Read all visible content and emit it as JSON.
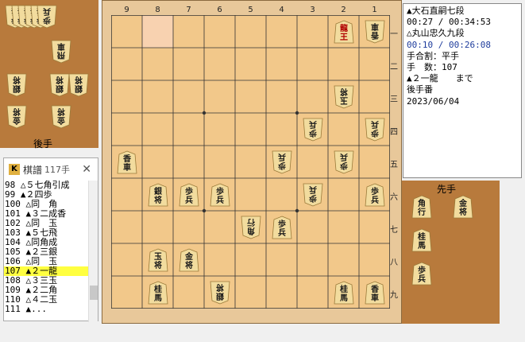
{
  "gote_hand": {
    "label": "後手",
    "pieces": [
      {
        "kind": "歩",
        "label": "歩兵"
      },
      {
        "kind": "歩",
        "label": "歩兵"
      },
      {
        "kind": "歩",
        "label": "歩兵"
      },
      {
        "kind": "歩",
        "label": "歩兵"
      },
      {
        "kind": "歩",
        "label": "歩兵"
      },
      {
        "kind": "歩",
        "label": "歩兵"
      },
      {
        "kind": "飛",
        "label": "飛車"
      },
      {
        "kind": "銀",
        "label": "銀将"
      },
      {
        "kind": "銀",
        "label": "銀将"
      },
      {
        "kind": "銀",
        "label": "銀将"
      },
      {
        "kind": "金",
        "label": "金将"
      },
      {
        "kind": "香",
        "label": "香車"
      },
      {
        "kind": "金",
        "label": "金将"
      }
    ]
  },
  "sente_hand": {
    "label": "先手",
    "pieces": [
      {
        "kind": "角",
        "label": "角行"
      },
      {
        "kind": "金",
        "label": "金将"
      },
      {
        "kind": "桂",
        "label": "桂馬"
      },
      {
        "kind": "歩",
        "label": "歩兵"
      }
    ]
  },
  "board": {
    "files": [
      "9",
      "8",
      "7",
      "6",
      "5",
      "4",
      "3",
      "2",
      "1"
    ],
    "ranks": [
      "一",
      "二",
      "三",
      "四",
      "五",
      "六",
      "七",
      "八",
      "九"
    ],
    "highlight": {
      "file": 8,
      "rank": 1
    },
    "pieces": [
      {
        "file": 2,
        "rank": 1,
        "label": "龍王",
        "owner": "sente"
      },
      {
        "file": 1,
        "rank": 1,
        "label": "香車",
        "owner": "gote"
      },
      {
        "file": 2,
        "rank": 3,
        "label": "玉将",
        "owner": "gote"
      },
      {
        "file": 3,
        "rank": 4,
        "label": "歩兵",
        "owner": "gote"
      },
      {
        "file": 1,
        "rank": 4,
        "label": "歩兵",
        "owner": "gote"
      },
      {
        "file": 9,
        "rank": 5,
        "label": "香車",
        "owner": "sente"
      },
      {
        "file": 4,
        "rank": 5,
        "label": "歩兵",
        "owner": "gote"
      },
      {
        "file": 2,
        "rank": 5,
        "label": "歩兵",
        "owner": "gote"
      },
      {
        "file": 8,
        "rank": 6,
        "label": "銀将",
        "owner": "sente"
      },
      {
        "file": 7,
        "rank": 6,
        "label": "歩兵",
        "owner": "sente"
      },
      {
        "file": 6,
        "rank": 6,
        "label": "歩兵",
        "owner": "sente"
      },
      {
        "file": 3,
        "rank": 6,
        "label": "歩兵",
        "owner": "gote"
      },
      {
        "file": 1,
        "rank": 6,
        "label": "歩兵",
        "owner": "sente"
      },
      {
        "file": 5,
        "rank": 7,
        "label": "角行",
        "owner": "gote"
      },
      {
        "file": 4,
        "rank": 7,
        "label": "歩兵",
        "owner": "sente"
      },
      {
        "file": 8,
        "rank": 8,
        "label": "玉将",
        "owner": "sente"
      },
      {
        "file": 7,
        "rank": 8,
        "label": "金将",
        "owner": "sente"
      },
      {
        "file": 8,
        "rank": 9,
        "label": "桂馬",
        "owner": "sente"
      },
      {
        "file": 6,
        "rank": 9,
        "label": "銀将",
        "owner": "gote"
      },
      {
        "file": 2,
        "rank": 9,
        "label": "桂馬",
        "owner": "sente"
      },
      {
        "file": 1,
        "rank": 9,
        "label": "香車",
        "owner": "sente"
      }
    ]
  },
  "info": {
    "sente_name": "▲大石直嗣七段",
    "sente_time": "00:27 / 00:34:53",
    "gote_name": "△丸山忠久九段",
    "gote_time": "00:10 / 00:26:08",
    "handicap": "手合割：平手",
    "move_count": "手　数：107",
    "last_move": "▲２一龍　　まで",
    "turn": "後手番",
    "date": "2023/06/04"
  },
  "kifu": {
    "title": "棋譜",
    "count": "117手",
    "selected_index": 9,
    "rows": [
      "98 △５七角引成",
      "99 ▲２四歩",
      "100 △同　角",
      "101 ▲３二成香",
      "102 △同　玉",
      "103 ▲５七飛",
      "104 △同角成",
      "105 ▲２三銀",
      "106 △同　玉",
      "107 ▲２一龍",
      "108 △３三玉",
      "109 ▲２二角",
      "110 △４二玉",
      "111 ▲..."
    ]
  }
}
